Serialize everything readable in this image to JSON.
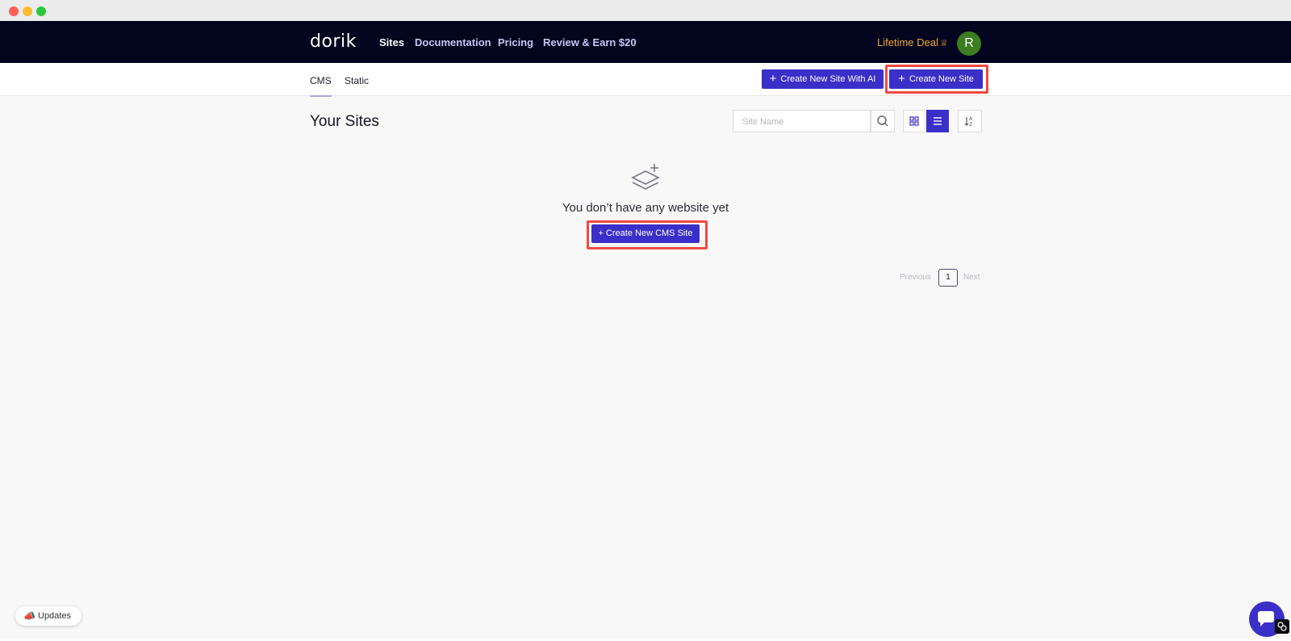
{
  "nav": {
    "logo": "dorik",
    "links": [
      "Sites",
      "Documentation",
      "Pricing",
      "Review & Earn $20"
    ],
    "lifetime_deal": "Lifetime Deal",
    "avatar_initial": "R"
  },
  "subnav": {
    "tabs": [
      "CMS",
      "Static"
    ],
    "create_ai_label": "Create New Site With AI",
    "create_label": "Create New Site"
  },
  "main": {
    "title": "Your Sites",
    "search_placeholder": "Site Name",
    "empty_text": "You don’t have any website yet",
    "create_cms_label": "+ Create New CMS Site"
  },
  "pagination": {
    "previous": "Previous",
    "page": "1",
    "next": "Next"
  },
  "widgets": {
    "updates_label": "Updates"
  },
  "colors": {
    "nav_bg": "#03041e",
    "primary": "#3b2fc9",
    "highlight": "#ef4a43",
    "lifetime": "#f0a733",
    "avatar": "#3a7e1f"
  }
}
